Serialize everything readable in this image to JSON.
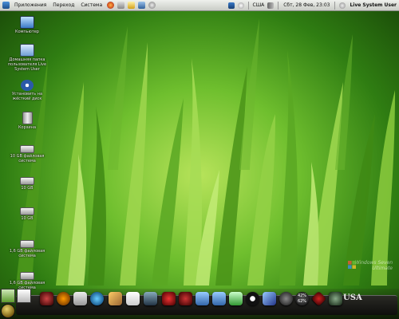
{
  "top_panel": {
    "menus": [
      "Приложения",
      "Переход",
      "Система"
    ],
    "launcher_icons": [
      "firefox-icon",
      "network-icon",
      "mail-icon",
      "screen-icon",
      "settings-icon"
    ],
    "tray_icons": [
      "gnome-icon",
      "toolbox-icon"
    ],
    "keyboard_layout": "США",
    "volume_icon": "volume-icon",
    "clock": "Сбт, 28 Фев, 23:03",
    "user": "Live System User"
  },
  "desktop": {
    "icons": [
      {
        "name": "computer",
        "icon": "monitor-icon",
        "label": "Компьютер"
      },
      {
        "name": "home-folder",
        "icon": "folder-icon",
        "label": "Домашняя папка пользователя Live System User"
      },
      {
        "name": "install",
        "icon": "fedora-icon",
        "label": "Установить на жёсткий диск"
      },
      {
        "name": "trash",
        "icon": "trash-icon",
        "label": "Корзина"
      },
      {
        "name": "drive-1",
        "icon": "drive-icon",
        "label": "10 GB файловая система"
      },
      {
        "name": "drive-2",
        "icon": "drive-icon",
        "label": "10 GB"
      },
      {
        "name": "drive-3",
        "icon": "drive-icon",
        "label": "10 GB"
      },
      {
        "name": "drive-4",
        "icon": "drive-icon",
        "label": "1,6 GB файловая система"
      },
      {
        "name": "drive-5",
        "icon": "drive-icon",
        "label": "1,6 GB файловая система"
      }
    ]
  },
  "watermark": {
    "line1": "Windows Seven",
    "line2": "Ultimate"
  },
  "dock": {
    "items": [
      "video-icon",
      "media-icon",
      "calculator-icon",
      "globe-icon",
      "tools-icon",
      "document-icon",
      "window-icon",
      "red-app-icon",
      "red-app-icon-2",
      "folder-icon",
      "folder-icon-2",
      "photo-icon",
      "power-icon",
      "cursor-icon",
      "disc-icon",
      "cpu-meter-icon",
      "red-diamond-icon",
      "gem-icon"
    ],
    "cpu_text": "42%",
    "mem_text": "62%",
    "usa_label": "USA"
  },
  "colors": {
    "panel": "#e0e2de",
    "grass_light": "#b7e35a",
    "grass_dark": "#1a4a08",
    "dock": "#0e0e0c"
  }
}
